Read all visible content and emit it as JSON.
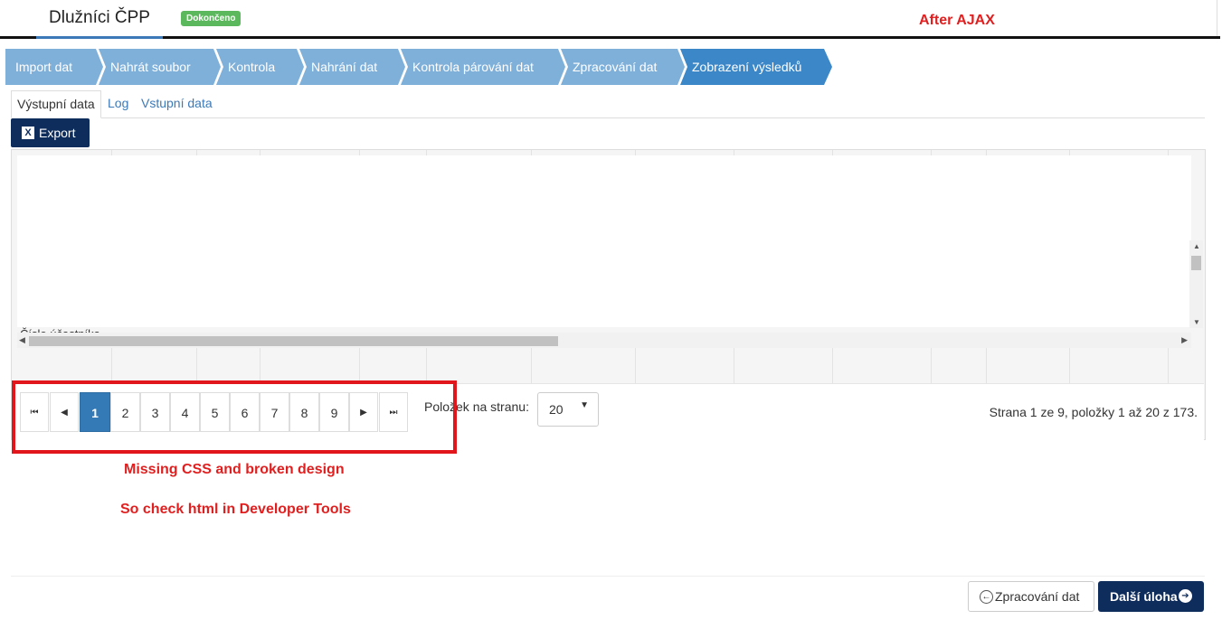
{
  "header": {
    "title": "Dlužníci ČPP",
    "status_badge": "Dokončeno"
  },
  "annotations": {
    "after_ajax": "After AJAX",
    "missing_css": "Missing CSS and broken design",
    "check_html": "So check html in Developer Tools"
  },
  "wizard": {
    "steps": [
      {
        "label": "Import dat"
      },
      {
        "label": "Nahrát soubor"
      },
      {
        "label": "Kontrola"
      },
      {
        "label": "Nahrání dat"
      },
      {
        "label": "Kontrola párování dat"
      },
      {
        "label": "Zpracování dat"
      },
      {
        "label": "Zobrazení výsledků",
        "active": true
      }
    ],
    "colors": {
      "inactive": "#7fb0da",
      "active": "#3b87c8"
    }
  },
  "tabs": {
    "output": "Výstupní data",
    "log": "Log",
    "input": "Vstupní data"
  },
  "toolbar": {
    "export_label": "Export",
    "export_icon": "excel-icon"
  },
  "grid": {
    "first_col_peek": "Číslo účastníka"
  },
  "pager": {
    "pages": [
      "1",
      "2",
      "3",
      "4",
      "5",
      "6",
      "7",
      "8",
      "9"
    ],
    "current_page": "1",
    "first_icon": "⏮",
    "prev_icon": "◀",
    "next_icon": "▶",
    "last_icon": "⏭",
    "per_page_label": "Položek na stranu:",
    "per_page_value": "20",
    "info": "Strana 1 ze 9, položky 1 až 20 z 173."
  },
  "footer": {
    "back_label": "Zpracování dat",
    "next_label": "Další úloha"
  },
  "colors": {
    "primary_dark": "#0e2d5c",
    "active_page": "#337ab7",
    "badge_green": "#5cb85c",
    "annotation_red": "#e02020"
  }
}
